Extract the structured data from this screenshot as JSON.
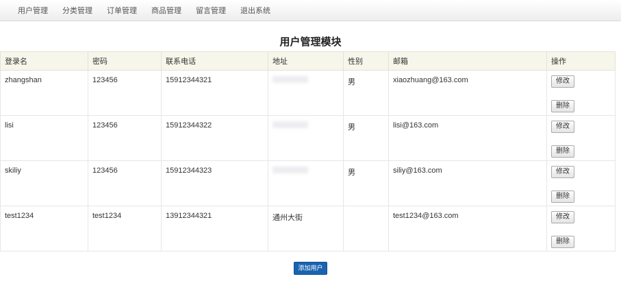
{
  "nav": {
    "items": [
      "用户管理",
      "分类管理",
      "订单管理",
      "商品管理",
      "留言管理",
      "退出系统"
    ]
  },
  "page_title": "用户管理模块",
  "table": {
    "headers": [
      "登录名",
      "密码",
      "联系电话",
      "地址",
      "性别",
      "邮箱",
      "操作"
    ],
    "rows": [
      {
        "login": "zhangshan",
        "password": "123456",
        "phone": "15912344321",
        "address": "",
        "gender": "男",
        "email": "xiaozhuang@163.com"
      },
      {
        "login": "lisi",
        "password": "123456",
        "phone": "15912344322",
        "address": "",
        "gender": "男",
        "email": "lisi@163.com"
      },
      {
        "login": "skiliy",
        "password": "123456",
        "phone": "15912344323",
        "address": "",
        "gender": "男",
        "email": "siliy@163.com"
      },
      {
        "login": "test1234",
        "password": "test1234",
        "phone": "13912344321",
        "address": "通州大街",
        "gender": "",
        "email": "test1234@163.com"
      }
    ],
    "edit_label": "修改",
    "delete_label": "删除"
  },
  "add_button_label": "添加用户"
}
